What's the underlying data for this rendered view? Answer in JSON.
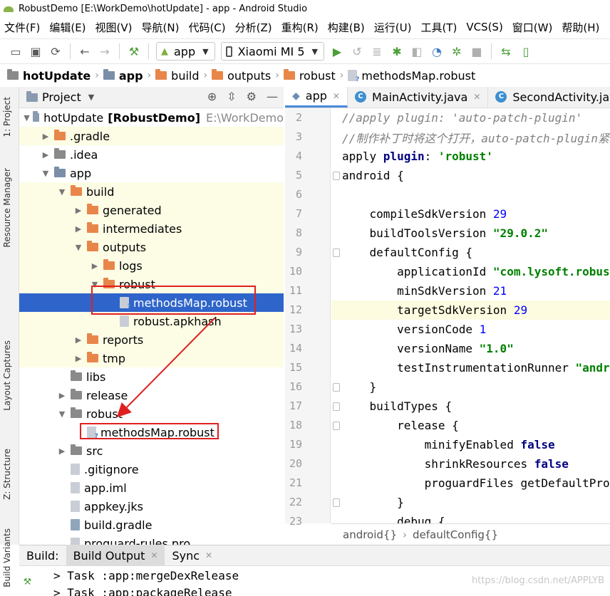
{
  "window": {
    "title": "RobustDemo [E:\\WorkDemo\\hotUpdate] - app - Android Studio"
  },
  "menu": [
    "文件(F)",
    "编辑(E)",
    "视图(V)",
    "导航(N)",
    "代码(C)",
    "分析(Z)",
    "重构(R)",
    "构建(B)",
    "运行(U)",
    "工具(T)",
    "VCS(S)",
    "窗口(W)",
    "帮助(H)"
  ],
  "toolbar": {
    "run_config": "app",
    "device": "Xiaomi MI 5"
  },
  "breadcrumbs": [
    "hotUpdate",
    "app",
    "build",
    "outputs",
    "robust",
    "methodsMap.robust"
  ],
  "project_panel": {
    "title": "Project"
  },
  "tree": [
    {
      "label": "hotUpdate",
      "bold_suffix": "[RobustDemo]",
      "hint": "E:\\WorkDemo",
      "depth": 0,
      "arrow": "down",
      "icon": "module",
      "bg": "white"
    },
    {
      "label": ".gradle",
      "depth": 1,
      "arrow": "right",
      "icon": "folder-orange",
      "bg": "yellow"
    },
    {
      "label": ".idea",
      "depth": 1,
      "arrow": "right",
      "icon": "folder",
      "bg": "white"
    },
    {
      "label": "app",
      "depth": 1,
      "arrow": "down",
      "icon": "folder-blue",
      "bg": "white"
    },
    {
      "label": "build",
      "depth": 2,
      "arrow": "down",
      "icon": "folder-orange",
      "bg": "yellow"
    },
    {
      "label": "generated",
      "depth": 3,
      "arrow": "right",
      "icon": "folder-orange",
      "bg": "yellow"
    },
    {
      "label": "intermediates",
      "depth": 3,
      "arrow": "right",
      "icon": "folder-orange",
      "bg": "yellow"
    },
    {
      "label": "outputs",
      "depth": 3,
      "arrow": "down",
      "icon": "folder-orange",
      "bg": "yellow"
    },
    {
      "label": "logs",
      "depth": 4,
      "arrow": "right",
      "icon": "folder-orange",
      "bg": "yellow"
    },
    {
      "label": "robust",
      "depth": 4,
      "arrow": "down",
      "icon": "folder-orange",
      "bg": "yellow"
    },
    {
      "label": "methodsMap.robust",
      "depth": 5,
      "arrow": "",
      "icon": "file-q",
      "bg": "selected"
    },
    {
      "label": "robust.apkhash",
      "depth": 5,
      "arrow": "",
      "icon": "file",
      "bg": "yellow"
    },
    {
      "label": "reports",
      "depth": 3,
      "arrow": "right",
      "icon": "folder-orange",
      "bg": "yellow"
    },
    {
      "label": "tmp",
      "depth": 3,
      "arrow": "right",
      "icon": "folder-orange",
      "bg": "yellow"
    },
    {
      "label": "libs",
      "depth": 2,
      "arrow": "",
      "icon": "folder",
      "bg": "white"
    },
    {
      "label": "release",
      "depth": 2,
      "arrow": "right",
      "icon": "folder",
      "bg": "white"
    },
    {
      "label": "robust",
      "depth": 2,
      "arrow": "down",
      "icon": "folder",
      "bg": "white"
    },
    {
      "label": "methodsMap.robust",
      "depth": 3,
      "arrow": "",
      "icon": "file-q",
      "bg": "white"
    },
    {
      "label": "src",
      "depth": 2,
      "arrow": "right",
      "icon": "folder",
      "bg": "white"
    },
    {
      "label": ".gitignore",
      "depth": 2,
      "arrow": "",
      "icon": "file",
      "bg": "white"
    },
    {
      "label": "app.iml",
      "depth": 2,
      "arrow": "",
      "icon": "file",
      "bg": "white"
    },
    {
      "label": "appkey.jks",
      "depth": 2,
      "arrow": "",
      "icon": "file",
      "bg": "white"
    },
    {
      "label": "build.gradle",
      "depth": 2,
      "arrow": "",
      "icon": "gradle",
      "bg": "white"
    },
    {
      "label": "proguard-rules.pro",
      "depth": 2,
      "arrow": "",
      "icon": "file",
      "bg": "white"
    }
  ],
  "editor_tabs": [
    {
      "label": "app",
      "icon": "gradle",
      "active": true
    },
    {
      "label": "MainActivity.java",
      "icon": "class",
      "active": false
    },
    {
      "label": "SecondActivity.java",
      "icon": "class",
      "active": false
    }
  ],
  "code_lines": [
    {
      "n": "2",
      "parts": [
        [
          "cmt",
          "//apply plugin: 'auto-patch-plugin'"
        ]
      ]
    },
    {
      "n": "3",
      "parts": [
        [
          "cmt",
          "//制作补丁时将这个打开，auto-patch-plugin紧跟着com.android.application"
        ]
      ]
    },
    {
      "n": "4",
      "parts": [
        [
          "",
          "apply "
        ],
        [
          "kw",
          "plugin"
        ],
        [
          "",
          ": "
        ],
        [
          "str",
          "'robust'"
        ]
      ]
    },
    {
      "n": "5",
      "parts": [
        [
          "",
          "android {"
        ]
      ],
      "fold": true
    },
    {
      "n": "6",
      "parts": []
    },
    {
      "n": "7",
      "parts": [
        [
          "",
          "    compileSdkVersion "
        ],
        [
          "num",
          "29"
        ]
      ]
    },
    {
      "n": "8",
      "parts": [
        [
          "",
          "    buildToolsVersion "
        ],
        [
          "str",
          "\"29.0.2\""
        ]
      ]
    },
    {
      "n": "9",
      "parts": [
        [
          "",
          "    defaultConfig {"
        ]
      ],
      "fold": true
    },
    {
      "n": "10",
      "parts": [
        [
          "",
          "        applicationId "
        ],
        [
          "str",
          "\"com.lysoft.robustdemo\""
        ]
      ]
    },
    {
      "n": "11",
      "parts": [
        [
          "",
          "        minSdkVersion "
        ],
        [
          "num",
          "21"
        ]
      ]
    },
    {
      "n": "12",
      "parts": [
        [
          "",
          "        targetSdkVersion "
        ],
        [
          "num",
          "29"
        ]
      ],
      "highlight": true
    },
    {
      "n": "13",
      "parts": [
        [
          "",
          "        versionCode "
        ],
        [
          "num",
          "1"
        ]
      ]
    },
    {
      "n": "14",
      "parts": [
        [
          "",
          "        versionName "
        ],
        [
          "str",
          "\"1.0\""
        ]
      ]
    },
    {
      "n": "15",
      "parts": [
        [
          "",
          "        testInstrumentationRunner "
        ],
        [
          "str",
          "\"androidx.test.runner.AndroidJUnitRunner\""
        ]
      ]
    },
    {
      "n": "16",
      "parts": [
        [
          "",
          "    }"
        ]
      ],
      "fold": true
    },
    {
      "n": "17",
      "parts": [
        [
          "",
          "    buildTypes {"
        ]
      ],
      "fold": true
    },
    {
      "n": "18",
      "parts": [
        [
          "",
          "        release {"
        ]
      ],
      "fold": true
    },
    {
      "n": "19",
      "parts": [
        [
          "",
          "            minifyEnabled "
        ],
        [
          "kw",
          "false"
        ]
      ]
    },
    {
      "n": "20",
      "parts": [
        [
          "",
          "            shrinkResources "
        ],
        [
          "kw",
          "false"
        ]
      ]
    },
    {
      "n": "21",
      "parts": [
        [
          "",
          "            proguardFiles getDefaultProguardFile("
        ]
      ]
    },
    {
      "n": "22",
      "parts": [
        [
          "",
          "        }"
        ]
      ],
      "fold": true
    },
    {
      "n": "23",
      "parts": [
        [
          "",
          "        debug {"
        ]
      ]
    }
  ],
  "editor_footer": {
    "crumb1": "android{}",
    "crumb2": "defaultConfig{}"
  },
  "build": {
    "label": "Build:",
    "tabs": [
      "Build Output",
      "Sync"
    ],
    "lines": [
      "> Task :app:mergeDexRelease",
      "> Task :app:packageRelease"
    ]
  },
  "left_tabs": [
    "1: Project",
    "Resource Manager",
    "Layout Captures",
    "Z: Structure",
    "Build Variants"
  ],
  "watermark": "https://blog.csdn.net/APPLYB"
}
